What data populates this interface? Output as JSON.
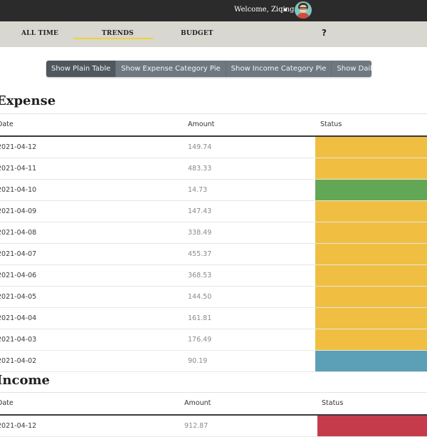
{
  "header": {
    "welcome": "Welcome, Ziqing"
  },
  "nav": {
    "all_time": "ALL TIME",
    "trends": "TRENDS",
    "budget": "BUDGET",
    "help": "?"
  },
  "view_buttons": [
    "Show Plain Table",
    "Show Expense Category Pie",
    "Show Income Category Pie",
    "Show Daily Line Chart"
  ],
  "colors": {
    "warning": "#f0bf42",
    "good": "#62a755",
    "info": "#5ba0b6",
    "danger": "#c63b4c"
  },
  "expense": {
    "title": "Expense",
    "columns": {
      "date": "Date",
      "amount": "Amount",
      "status": "Status"
    },
    "rows": [
      {
        "date": "2021-04-12",
        "amount": "149.74",
        "status": "warning"
      },
      {
        "date": "2021-04-11",
        "amount": "483.33",
        "status": "warning"
      },
      {
        "date": "2021-04-10",
        "amount": "14.73",
        "status": "good"
      },
      {
        "date": "2021-04-09",
        "amount": "147.43",
        "status": "warning"
      },
      {
        "date": "2021-04-08",
        "amount": "338.49",
        "status": "warning"
      },
      {
        "date": "2021-04-07",
        "amount": "455.37",
        "status": "warning"
      },
      {
        "date": "2021-04-06",
        "amount": "368.53",
        "status": "warning"
      },
      {
        "date": "2021-04-05",
        "amount": "144.50",
        "status": "warning"
      },
      {
        "date": "2021-04-04",
        "amount": "161.81",
        "status": "warning"
      },
      {
        "date": "2021-04-03",
        "amount": "176.49",
        "status": "warning"
      },
      {
        "date": "2021-04-02",
        "amount": "90.19",
        "status": "info"
      }
    ]
  },
  "income": {
    "title": "Income",
    "columns": {
      "date": "Date",
      "amount": "Amount",
      "status": "Status"
    },
    "rows": [
      {
        "date": "2021-04-12",
        "amount": "912.87",
        "status": "danger"
      }
    ]
  }
}
